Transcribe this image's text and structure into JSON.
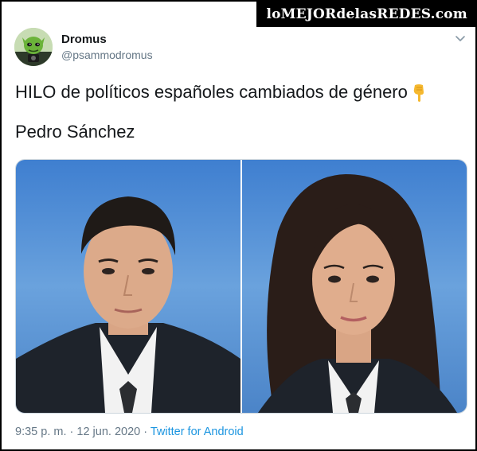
{
  "watermark": "loMEJORdelasREDES.com",
  "tweet": {
    "display_name": "Dromus",
    "handle": "@psammodromus",
    "text_line1": "HILO de políticos españoles cambiados de género",
    "text_line2": "Pedro Sánchez",
    "time": "9:35 p. m.",
    "separator1": " · ",
    "date": "12 jun. 2020",
    "separator2": " · ",
    "source": "Twitter for Android"
  },
  "icons": {
    "avatar": "alien-avatar-icon",
    "menu": "chevron-down-icon",
    "emoji": "backhand-index-pointing-down-emoji"
  },
  "colors": {
    "text": "#14171a",
    "secondary": "#657786",
    "link": "#1b95e0",
    "photo_background": "#4f86c9"
  }
}
